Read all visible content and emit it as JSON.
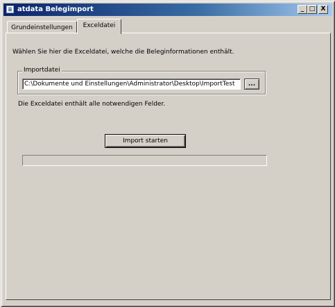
{
  "window": {
    "title": "atdata Belegimport",
    "icon": "app-icon",
    "controls": {
      "minimize": "_",
      "maximize": "□",
      "close": "X"
    }
  },
  "tabs": [
    {
      "label": "Grundeinstellungen",
      "selected": false
    },
    {
      "label": "Exceldatei",
      "selected": true
    }
  ],
  "panel": {
    "instruction": "Wählen Sie hier die Exceldatei, welche die Beleginformationen enthält.",
    "import_group": {
      "legend": "Importdatei",
      "path_value": "C:\\Dokumente und Einstellungen\\Administrator\\Desktop\\ImportTest",
      "browse_label": "..."
    },
    "status": "Die Exceldatei enthält alle notwendigen Felder.",
    "import_button": "Import starten",
    "progress": 0
  },
  "colors": {
    "face": "#d4d0c8",
    "title_active": "#0a246a",
    "title_gradient_end": "#a6caf0"
  }
}
